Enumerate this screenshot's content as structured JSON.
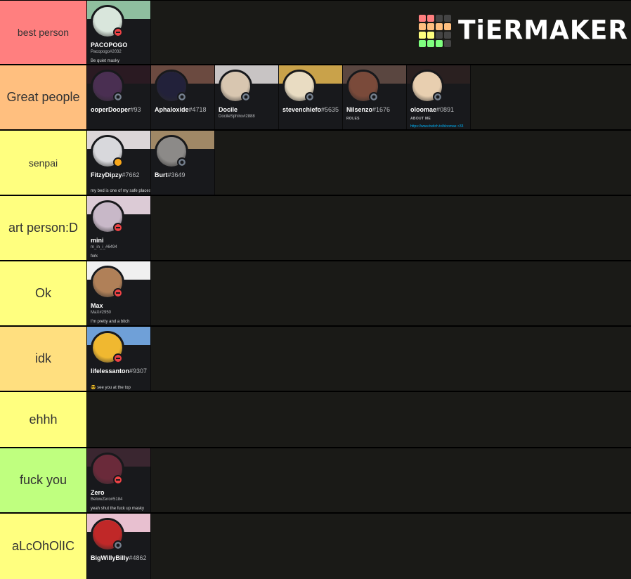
{
  "logo": {
    "text": "TiERMAKER",
    "grid_colors": [
      "#ff7f7f",
      "#ff7f7f",
      "#444444",
      "#444444",
      "#ffbf7f",
      "#ffbf7f",
      "#ffbf7f",
      "#ffbf7f",
      "#ffff7f",
      "#ffff7f",
      "#444444",
      "#444444",
      "#7fff7f",
      "#7fff7f",
      "#7fff7f",
      "#444444"
    ]
  },
  "tiers": [
    {
      "label": "best person",
      "color": "#ff7f7f",
      "items": [
        {
          "name": "PACOPOGO",
          "disc": "",
          "tag": "Pacopogo#2032",
          "about": "Be quiet masky",
          "status": "dnd",
          "banner": "#8fbf9f",
          "avatar": "#d9e6dc"
        }
      ]
    },
    {
      "label": "Great people",
      "color": "#ffbf7f",
      "items": [
        {
          "name": "ooperDooper",
          "disc": "#93",
          "tag": "",
          "about": "",
          "status": "offline",
          "banner": "#2a1a22",
          "avatar": "#4a2f52"
        },
        {
          "name": "Aphaloxide",
          "disc": "#4718",
          "tag": "",
          "about": "",
          "status": "offline",
          "banner": "#6b4a40",
          "avatar": "#22213a"
        },
        {
          "name": "Docile",
          "disc": "",
          "tag": "DocileSphinx#2888",
          "about": "",
          "status": "offline",
          "banner": "#c8c4c4",
          "avatar": "#d8c6b0"
        },
        {
          "name": "stevenchiefo",
          "disc": "#5635",
          "tag": "",
          "about": "",
          "status": "offline",
          "banner": "#c9a24a",
          "avatar": "#e9dcc2"
        },
        {
          "name": "Nilsenzo",
          "disc": "#1676",
          "tag": "",
          "sub": "ROLES",
          "about": "",
          "status": "offline",
          "banner": "#5a4640",
          "avatar": "#7a4a3a"
        },
        {
          "name": "oloomae",
          "disc": "#0891",
          "tag": "",
          "sub": "ABOUT ME",
          "link": "https://www.twitch.tv/bloomae <33",
          "status": "offline",
          "banner": "#2a2020",
          "avatar": "#e8cfb0"
        }
      ]
    },
    {
      "label": "senpai",
      "color": "#ffff7f",
      "items": [
        {
          "name": "FitzyDipzy",
          "disc": "#7662",
          "tag": "",
          "about": "my bed is one of my safe places",
          "status": "idle",
          "banner": "#dcd6d8",
          "avatar": "#d8d8dc"
        },
        {
          "name": "Burt",
          "disc": "#3649",
          "tag": "",
          "about": "",
          "status": "offline",
          "banner": "#a08866",
          "avatar": "#8c8a88"
        }
      ]
    },
    {
      "label": "art person:D",
      "color": "#ffff7f",
      "items": [
        {
          "name": "mini",
          "disc": "",
          "tag": "m_in_i_#6494",
          "about": "fork",
          "status": "dnd",
          "banner": "#dccbd6",
          "avatar": "#c8b8c8"
        }
      ]
    },
    {
      "label": "Ok",
      "color": "#ffff7f",
      "items": [
        {
          "name": "Max",
          "disc": "",
          "tag": "MaX#2950",
          "about": "I'm pretty and a bitch",
          "status": "dnd",
          "banner": "#f0f0f0",
          "avatar": "#b08058"
        }
      ]
    },
    {
      "label": "idk",
      "color": "#ffdf7f",
      "items": [
        {
          "name": "lifelessanton",
          "disc": "#9307",
          "tag": "",
          "about": "😎 see you at the top",
          "status": "dnd",
          "banner": "#6fa0d8",
          "avatar": "#f0b830"
        }
      ]
    },
    {
      "label": "ehhh",
      "color": "#ffff7f",
      "items": []
    },
    {
      "label": "fuck you",
      "color": "#bfff7f",
      "items": [
        {
          "name": "Zero",
          "disc": "",
          "tag": "BelowZero#5184",
          "about": "yeah shut the fuck up masky",
          "status": "dnd",
          "banner": "#3a2630",
          "avatar": "#6a2a3a"
        }
      ]
    },
    {
      "label": "aLcOhOlIC",
      "color": "#ffff7f",
      "items": [
        {
          "name": "BigWillyBilly",
          "disc": "#4862",
          "tag": "",
          "about": "",
          "status": "offline",
          "banner": "#e8c0d0",
          "avatar": "#c02828"
        }
      ]
    }
  ]
}
